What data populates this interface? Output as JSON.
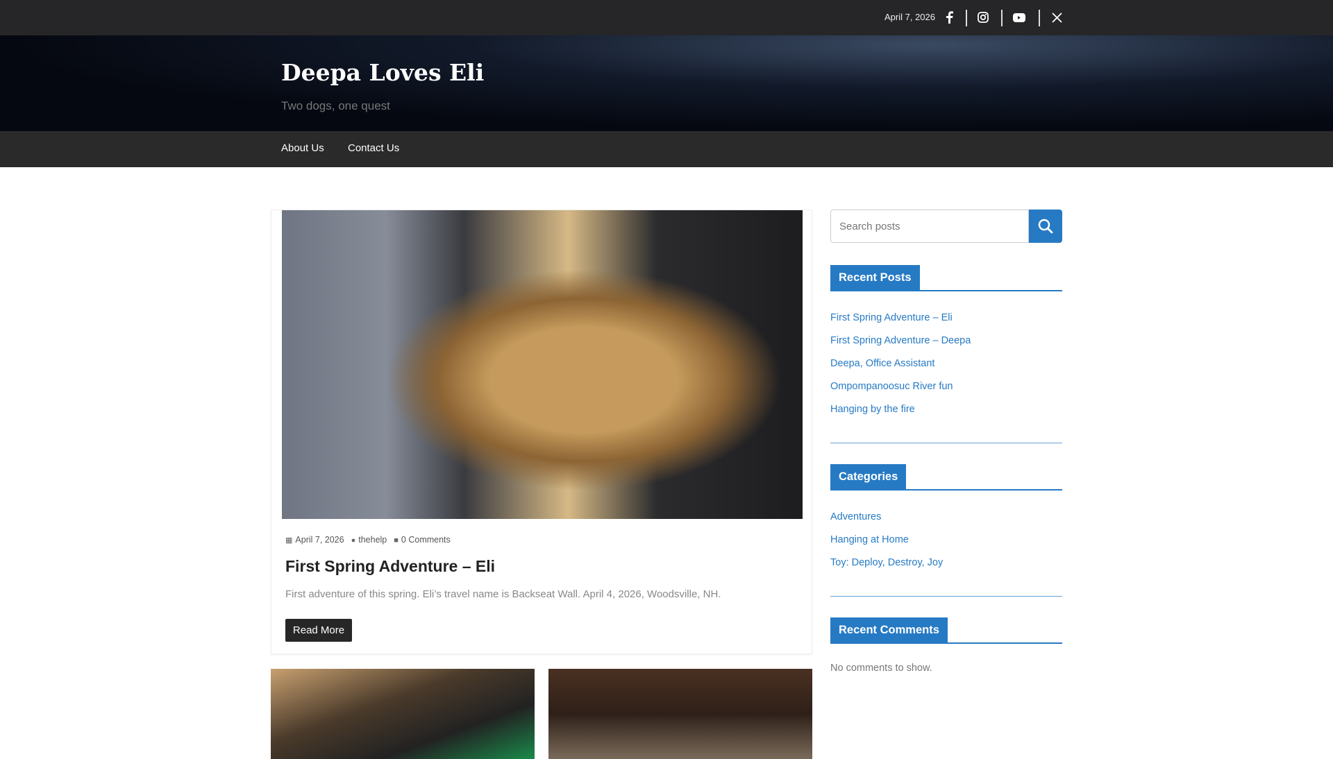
{
  "topbar": {
    "date": "April 7, 2026",
    "social": [
      "facebook-icon",
      "instagram-icon",
      "youtube-icon",
      "x-icon"
    ]
  },
  "header": {
    "title": "Deepa Loves Eli",
    "tagline": "Two dogs, one quest"
  },
  "nav": [
    "About Us",
    "Contact Us"
  ],
  "post": {
    "date": "April 7, 2026",
    "author": "thehelp",
    "comments": "0 Comments",
    "title": "First Spring Adventure – Eli",
    "excerpt": "First adventure of this spring. Eli’s travel name is Backseat Wall. April 4, 2026, Woodsville, NH.",
    "read_more": "Read More"
  },
  "sidebar": {
    "search_placeholder": "Search posts",
    "recent_posts": {
      "title": "Recent Posts",
      "items": [
        "First Spring Adventure – Eli",
        "First Spring Adventure – Deepa",
        "Deepa, Office Assistant",
        "Ompompanoosuc River fun",
        "Hanging by the fire"
      ]
    },
    "categories": {
      "title": "Categories",
      "items": [
        "Adventures",
        "Hanging at Home",
        "Toy: Deploy, Destroy, Joy"
      ]
    },
    "recent_comments": {
      "title": "Recent Comments",
      "empty": "No comments to show."
    }
  },
  "colors": {
    "accent": "#267ac4",
    "topbar": "#262628",
    "nav": "#2a2a2a"
  }
}
